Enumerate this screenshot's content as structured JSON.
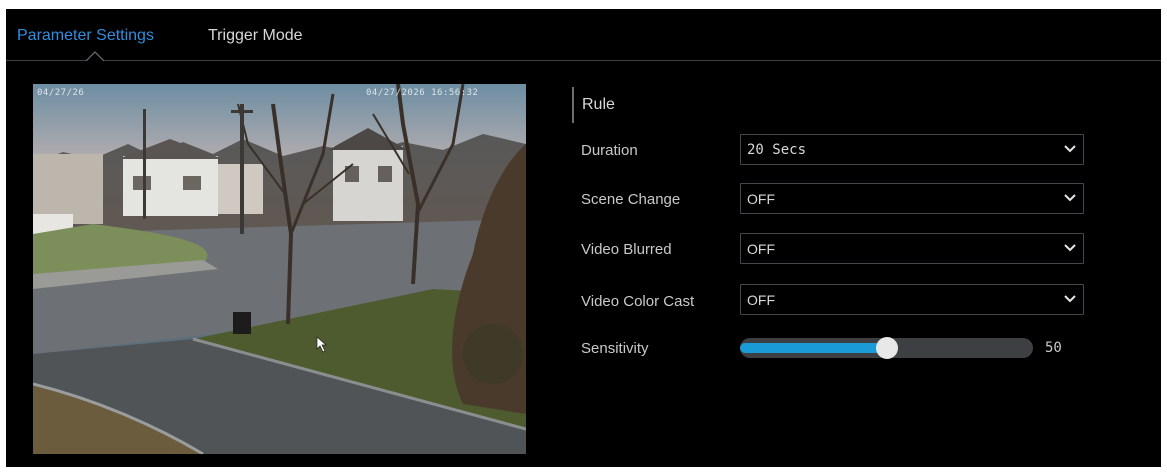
{
  "tabs": [
    {
      "label": "Parameter Settings",
      "active": true
    },
    {
      "label": "Trigger Mode",
      "active": false
    }
  ],
  "preview": {
    "osd_left": "04/27/26",
    "osd_right": "04/27/2026 16:56:32"
  },
  "settings": {
    "section_title": "Rule",
    "duration": {
      "label": "Duration",
      "value": "20 Secs"
    },
    "scene_change": {
      "label": "Scene Change",
      "value": "OFF"
    },
    "video_blurred": {
      "label": "Video Blurred",
      "value": "OFF"
    },
    "video_color_cast": {
      "label": "Video Color Cast",
      "value": "OFF"
    },
    "sensitivity": {
      "label": "Sensitivity",
      "value": "50",
      "level": 0.5
    }
  },
  "colors": {
    "accent": "#2f8ee0",
    "slider_fill": "#1a9ad6",
    "background": "#000000"
  }
}
